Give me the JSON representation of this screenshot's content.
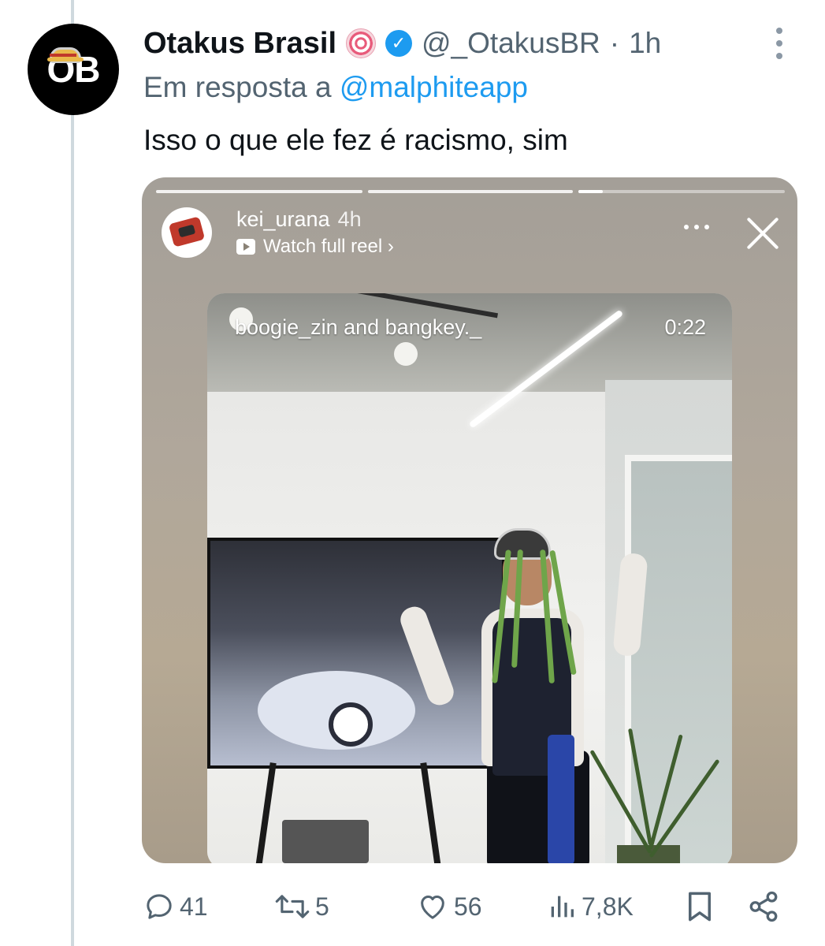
{
  "tweet": {
    "avatar_text": "ŌB",
    "display_name": "Otakus Brasil",
    "handle": "@_OtakusBR",
    "separator": "·",
    "time": "1h",
    "reply_prefix": "Em resposta a",
    "reply_mention": "@malphiteapp",
    "text": "Isso o que ele fez é racismo, sim"
  },
  "story": {
    "username": "kei_urana",
    "time": "4h",
    "watch_label": "Watch full reel ›",
    "video_caption": "boogie_zin and bangkey._",
    "video_duration": "0:22",
    "progress_fraction": 0.12
  },
  "actions": {
    "replies": "41",
    "retweets": "5",
    "likes": "56",
    "views": "7,8K"
  },
  "icons": {
    "verified": "verified-check-icon",
    "badge": "spiral-emoji-icon",
    "more": "more-vertical-icon",
    "reply": "reply-icon",
    "retweet": "retweet-icon",
    "like": "heart-icon",
    "views": "views-icon",
    "bookmark": "bookmark-icon",
    "share": "share-icon"
  },
  "colors": {
    "accent": "#1d9bf0",
    "muted": "#536471",
    "text": "#0f1419"
  }
}
